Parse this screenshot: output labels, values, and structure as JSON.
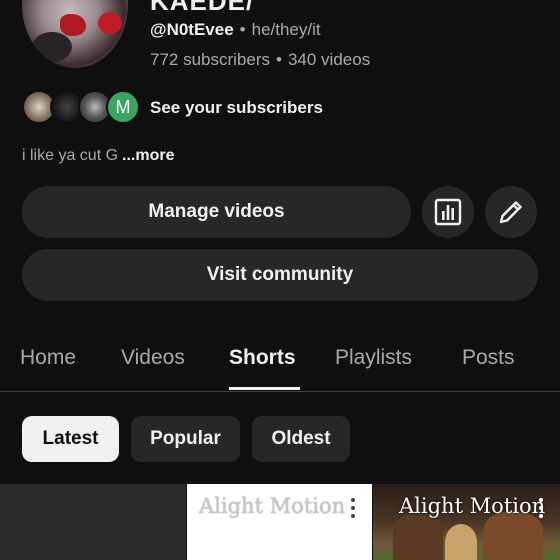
{
  "channel": {
    "name": "KAEDE/",
    "handle": "@N0tEvee",
    "pronouns": "he/they/it",
    "subscribers": "772 subscribers",
    "videos": "340 videos",
    "subscribers_link": "See your subscribers",
    "subscriber_initial": "M",
    "description": "i like ya cut G",
    "more_label": "...more"
  },
  "actions": {
    "manage_videos": "Manage videos",
    "visit_community": "Visit community",
    "analytics_icon": "analytics-icon",
    "edit_icon": "pencil-icon"
  },
  "tabs": [
    {
      "label": "Home"
    },
    {
      "label": "Videos"
    },
    {
      "label": "Shorts",
      "active": true
    },
    {
      "label": "Playlists"
    },
    {
      "label": "Posts"
    }
  ],
  "chips": [
    {
      "label": "Latest",
      "selected": true
    },
    {
      "label": "Popular"
    },
    {
      "label": "Oldest"
    }
  ],
  "shorts": [
    {
      "watermark": ""
    },
    {
      "watermark": "Alight Motion"
    },
    {
      "watermark": "Alight Motion"
    }
  ],
  "colors": {
    "background": "#0f0f0f",
    "button_bg": "#272727",
    "text_primary": "#f1f1f1",
    "text_secondary": "#aaaaaa",
    "subscriber_green": "#3aa55c"
  }
}
